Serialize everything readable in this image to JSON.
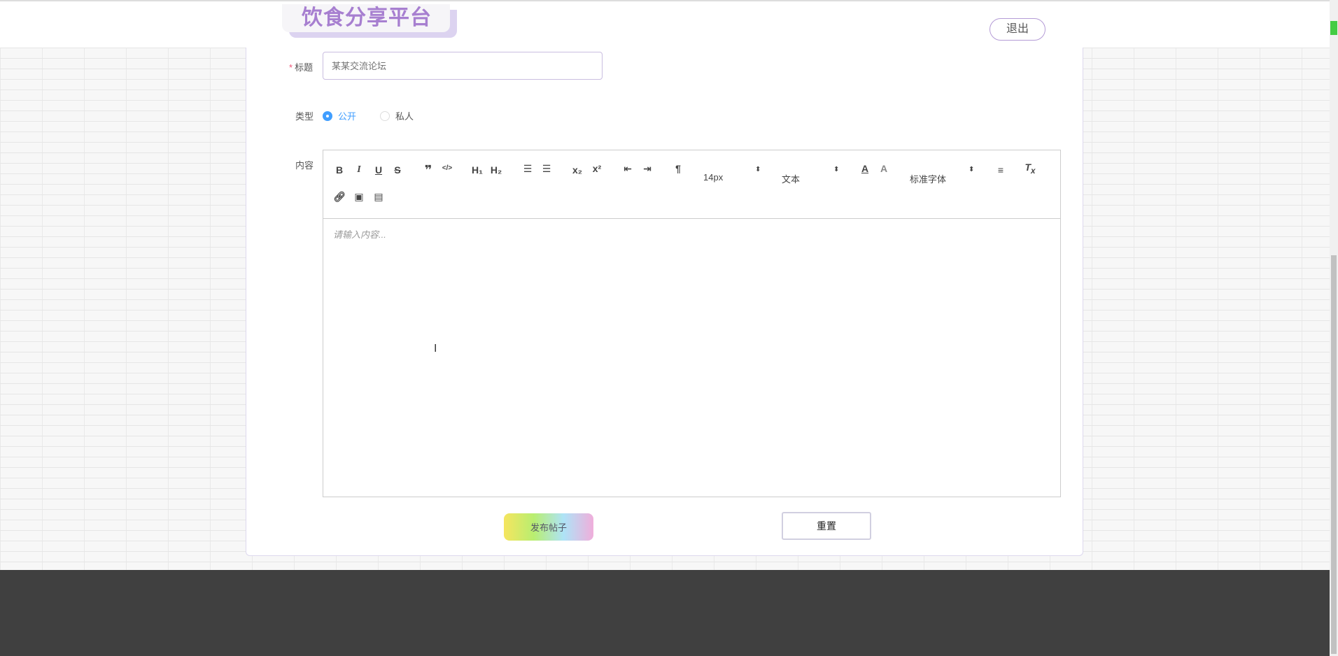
{
  "header": {
    "logo": "饮食分享平台",
    "logout": "退出"
  },
  "form": {
    "title_label": "标题",
    "required_mark": "*",
    "title_placeholder": "某某交流论坛",
    "type_label": "类型",
    "type_options": [
      {
        "label": "公开",
        "selected": true
      },
      {
        "label": "私人",
        "selected": false
      }
    ],
    "content_label": "内容",
    "toolbar": {
      "size": "14px",
      "header": "文本",
      "font": "标准字体"
    },
    "content_placeholder": "请输入内容...",
    "publish": "发布帖子",
    "reset": "重置"
  },
  "colors": {
    "accent": "#a77fd0",
    "radio": "#409eff",
    "footer": "#404040"
  }
}
